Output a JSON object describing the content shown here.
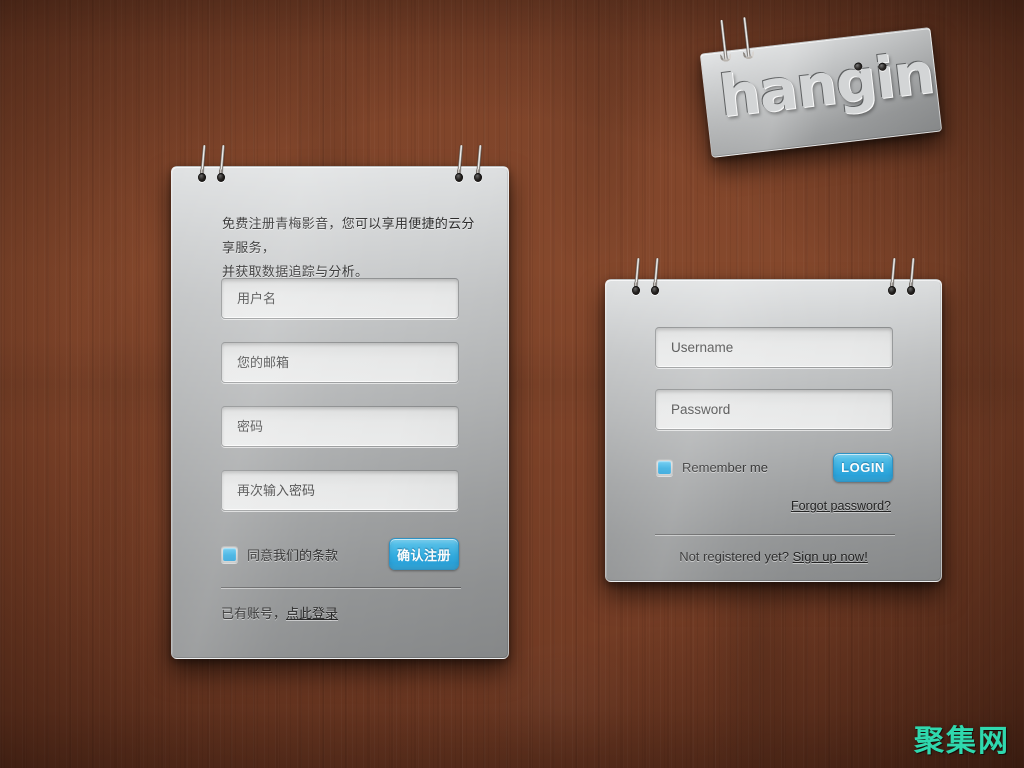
{
  "theme": {
    "wood_dark": "#3d2018",
    "wood_mid": "#7a4027",
    "wood_light": "#85482c",
    "panel_top": "#e0e2e3",
    "panel_bottom": "#8b8d8e",
    "accent_blue": "#33aee2",
    "accent_blue_light": "#7ed1ef",
    "watermark_teal": "#2fd8ae"
  },
  "hanging_sign": {
    "text": "hanging",
    "holes": 2,
    "rings": 2
  },
  "register_panel": {
    "intro_line1": "免费注册青梅影音，您可以享用便捷的云分享服务，",
    "intro_line2": "并获取数据追踪与分析。",
    "fields": [
      {
        "name": "username",
        "placeholder": "用户名",
        "value": ""
      },
      {
        "name": "email",
        "placeholder": "您的邮箱",
        "value": ""
      },
      {
        "name": "password",
        "placeholder": "密码",
        "value": ""
      },
      {
        "name": "password_confirm",
        "placeholder": "再次输入密码",
        "value": ""
      }
    ],
    "terms_checkbox": {
      "label": "同意我们的条款",
      "checked": true
    },
    "submit_label": "确认注册",
    "footer_text": "已有账号，",
    "footer_link": "点此登录"
  },
  "login_panel": {
    "fields": [
      {
        "name": "username",
        "placeholder": "Username",
        "value": ""
      },
      {
        "name": "password",
        "placeholder": "Password",
        "value": ""
      }
    ],
    "remember_checkbox": {
      "label": "Remember me",
      "checked": true
    },
    "submit_label": "LOGIN",
    "forgot_link": "Forgot password?",
    "footer_text": "Not registered yet? ",
    "footer_link": "Sign up now!"
  },
  "watermark": {
    "text": "聚集网"
  }
}
